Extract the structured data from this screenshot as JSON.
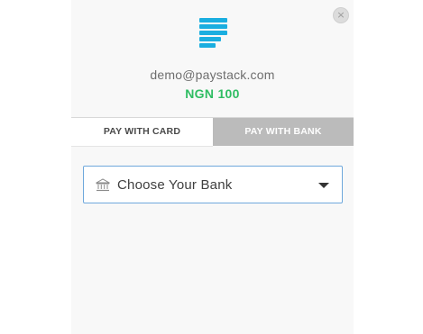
{
  "header": {
    "close_label": "×",
    "email": "demo@paystack.com",
    "amount": "NGN 100",
    "accent_color": "#1aaee0",
    "amount_color": "#2fbd63"
  },
  "tabs": [
    {
      "label": "PAY WITH CARD",
      "active": false
    },
    {
      "label": "PAY WITH BANK",
      "active": true
    }
  ],
  "bank_select": {
    "icon": "bank-icon",
    "placeholder": "Choose Your Bank"
  }
}
